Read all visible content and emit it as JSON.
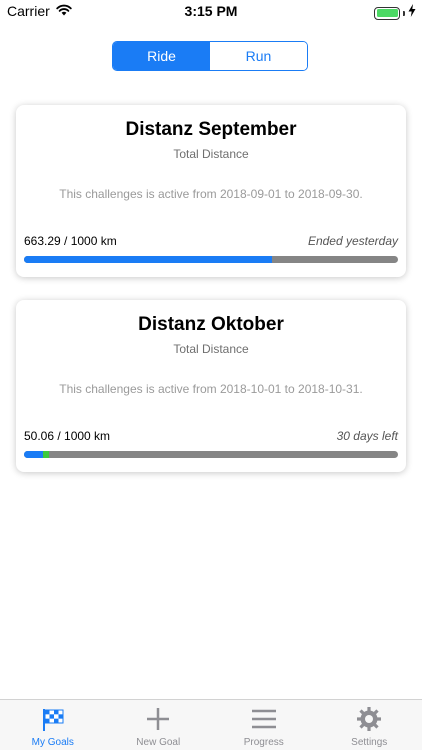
{
  "status_bar": {
    "carrier": "Carrier",
    "time": "3:15 PM"
  },
  "segmented": {
    "options": [
      "Ride",
      "Run"
    ],
    "selected": "Ride"
  },
  "goals": [
    {
      "title": "Distanz September",
      "subtitle": "Total Distance",
      "description": "This challenges is active from 2018-09-01 to 2018-09-30.",
      "progress_text": "663.29 / 1000 km",
      "status": "Ended yesterday",
      "progress_fraction": 0.663
    },
    {
      "title": "Distanz Oktober",
      "subtitle": "Total Distance",
      "description": "This challenges is active from 2018-10-01 to 2018-10-31.",
      "progress_text": "50.06 / 1000 km",
      "status": "30 days left",
      "progress_fraction": 0.05
    }
  ],
  "tab_bar": {
    "tabs": [
      {
        "label": "My Goals",
        "icon": "checkered-flag-icon",
        "active": true
      },
      {
        "label": "New Goal",
        "icon": "plus-icon",
        "active": false
      },
      {
        "label": "Progress",
        "icon": "list-icon",
        "active": false
      },
      {
        "label": "Settings",
        "icon": "gear-icon",
        "active": false
      }
    ]
  },
  "colors": {
    "accent": "#1a7cf5",
    "progress_track": "#858585",
    "progress_green": "#3ec93e",
    "inactive_tab": "#8e8e93"
  }
}
